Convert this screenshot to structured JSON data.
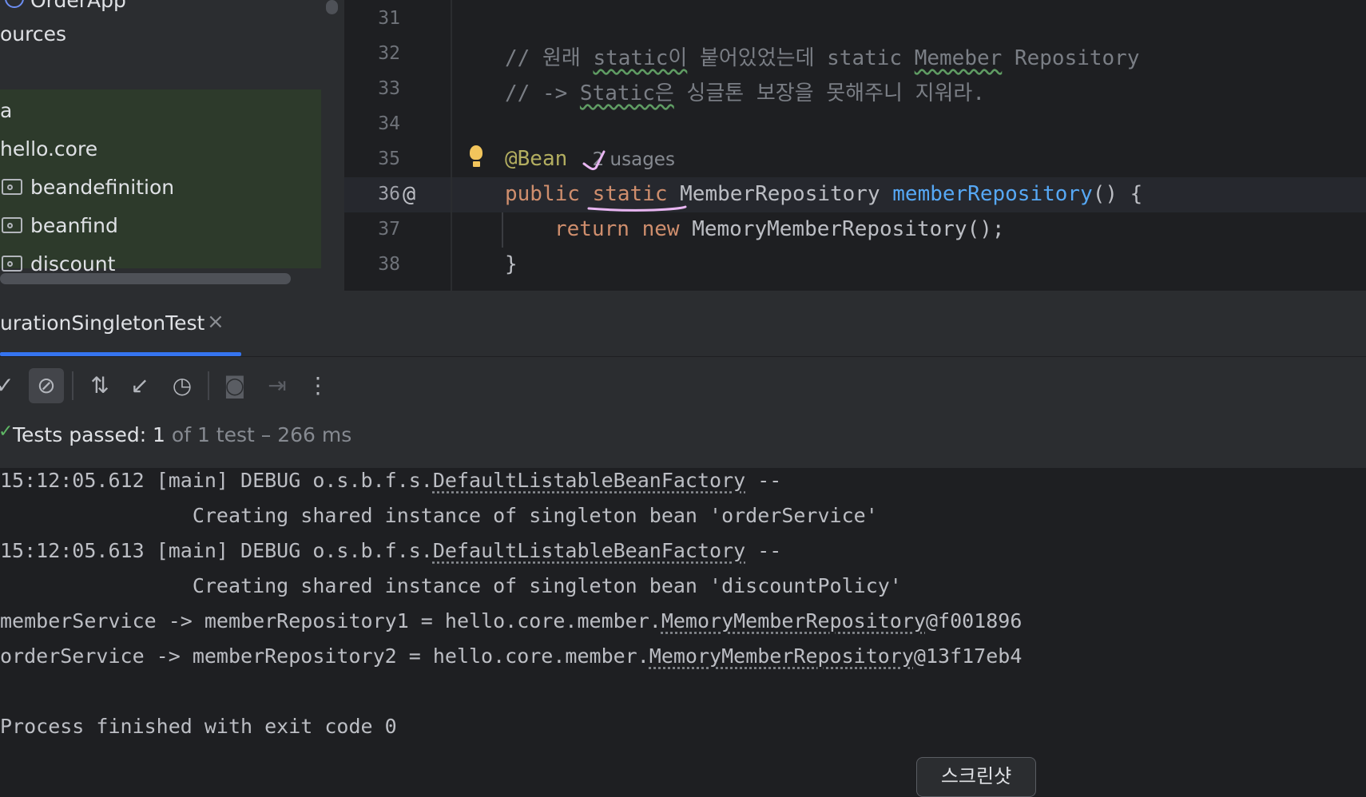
{
  "project_tree": {
    "items": [
      {
        "label": "OrderApp",
        "kind": "class"
      },
      {
        "label": "ources",
        "kind": "folder"
      },
      {
        "label": "a",
        "kind": "package"
      },
      {
        "label": "hello.core",
        "kind": "package"
      },
      {
        "label": "beandefinition",
        "kind": "package"
      },
      {
        "label": "beanfind",
        "kind": "package"
      },
      {
        "label": "discount",
        "kind": "package"
      }
    ]
  },
  "editor": {
    "line_numbers": [
      "31",
      "32",
      "33",
      "34",
      "35",
      "36",
      "37",
      "38"
    ],
    "comment1_a": "// 원래 ",
    "comment1_b": "static이",
    "comment1_c": " 붙어있었는데 static ",
    "comment1_d": "Memeber",
    "comment1_e": " Repository",
    "comment2_a": "// -> ",
    "comment2_b": "Static은",
    "comment2_c": " 싱글톤 보장을 못해주니 지워라.",
    "annotation": "@Bean",
    "usages_hint": "2 usages",
    "kw_public": "public",
    "kw_static": "static",
    "return_type": "MemberRepository",
    "method_name": "memberRepository",
    "method_tail": "() {",
    "kw_return": "return",
    "kw_new": "new",
    "constructor_call": "MemoryMemberRepository();",
    "closing_brace": "}"
  },
  "run_panel": {
    "tab_title": "urationSingletonTest",
    "status_bold": "Tests passed: 1",
    "status_rest": " of 1 test – 266 ms"
  },
  "console": {
    "line1_a": "15:12:05.612 [main] DEBUG o.s.b.f.s.",
    "line1_b": "DefaultListableBeanFactory",
    "line1_c": " --",
    "line2": "                Creating shared instance of singleton bean 'orderService'",
    "line3_a": "15:12:05.613 [main] DEBUG o.s.b.f.s.",
    "line3_b": "DefaultListableBeanFactory",
    "line3_c": " --",
    "line4": "                Creating shared instance of singleton bean 'discountPolicy'",
    "line5_a": "memberService -> memberRepository1 = hello.core.member.",
    "line5_b": "MemoryMemberRepository",
    "line5_c": "@f001896",
    "line6_a": "orderService -> memberRepository2 = hello.core.member.",
    "line6_b": "MemoryMemberRepository",
    "line6_c": "@13f17eb4",
    "line7": "Process finished with exit code 0"
  },
  "tooltip": {
    "label": "스크린샷"
  },
  "icons": [
    "class-icon",
    "folder-icon",
    "bulb-icon",
    "at-gutter-icon",
    "close-icon",
    "check-icon",
    "stop-icon",
    "sort-icon",
    "collapse-icon",
    "history-icon",
    "camera-icon",
    "import-icon",
    "more-icon"
  ],
  "colors": {
    "accent": "#3574f0",
    "annotation_ink": "#e9b6f2",
    "passed": "#5fb865"
  }
}
